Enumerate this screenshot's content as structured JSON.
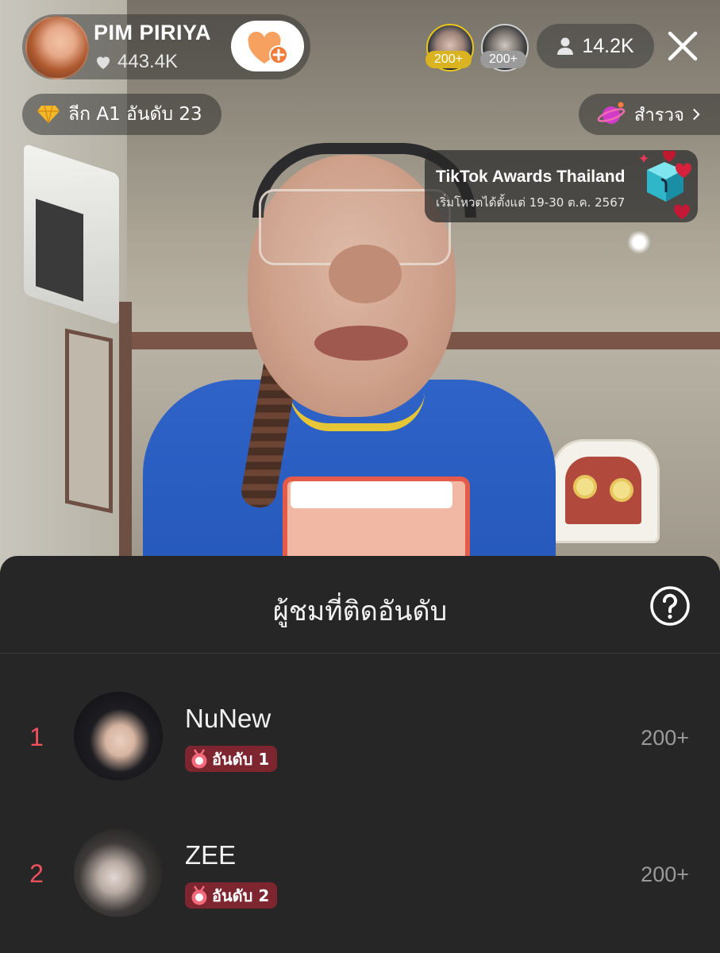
{
  "host": {
    "name": "PIM PIRIYA",
    "likes": "443.4K",
    "avatar_icon": "host-avatar",
    "follow_icon": "heart-plus-icon"
  },
  "top_gifters": [
    {
      "badge": "200+",
      "color": "#d9b420"
    },
    {
      "badge": "200+",
      "color": "#9a9a9a"
    }
  ],
  "viewer_count": "14.2K",
  "league": {
    "label": "ลีก A1 อันดับ 23",
    "icon": "diamond-icon"
  },
  "explore": {
    "label": "สำรวจ",
    "icon": "planet-icon"
  },
  "awards": {
    "title": "TikTok Awards Thailand",
    "subtitle": "เริ่มโหวตได้ตั้งแต่ 19-30 ต.ค. 2567"
  },
  "sheet": {
    "title": "ผู้ชมที่ติดอันดับ",
    "help_icon": "question-circle-icon",
    "rows": [
      {
        "rank": "1",
        "name": "NuNew",
        "badge": "อันดับ 1",
        "score": "200+"
      },
      {
        "rank": "2",
        "name": "ZEE",
        "badge": "อันดับ 2",
        "score": "200+"
      }
    ]
  },
  "colors": {
    "rank_red": "#f0515e",
    "badge_bg": "#7d2630",
    "sheet_bg": "#262626"
  }
}
